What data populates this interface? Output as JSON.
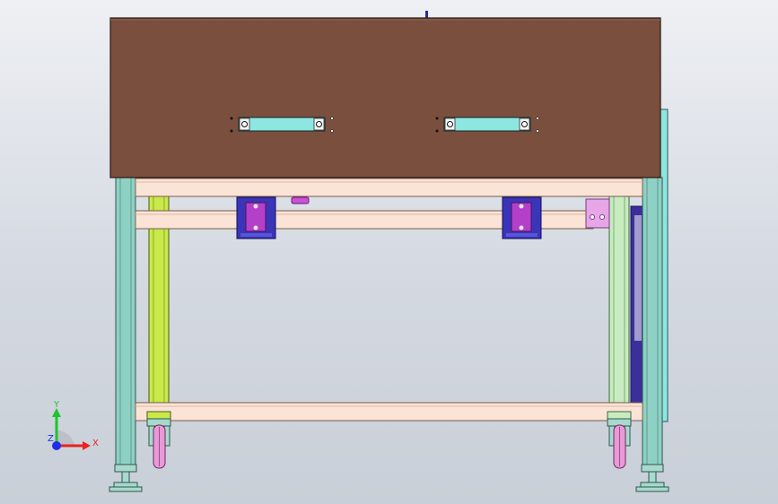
{
  "viewport": {
    "background_top": "#eef0f4",
    "background_bottom": "#c9cfd8"
  },
  "model": {
    "tabletop_color": "#7a4f3e",
    "frame_rail_color": "#fbe4d6",
    "leg_color": "#8fd0c4",
    "front_leg_color": "#c9e84a",
    "bracket_color": "#3a35b8",
    "bracket_inner_color": "#b43fc9",
    "handle_color": "#8ee6e0",
    "caster_color": "#e79ad6",
    "foot_color": "#a9d9cc",
    "side_panel_color": "#3b2f9a"
  },
  "triad": {
    "x_label": "X",
    "y_label": "Y",
    "z_label": "Z",
    "x_color": "#e8231f",
    "y_color": "#1ec42b",
    "z_color": "#1f2ee8"
  }
}
